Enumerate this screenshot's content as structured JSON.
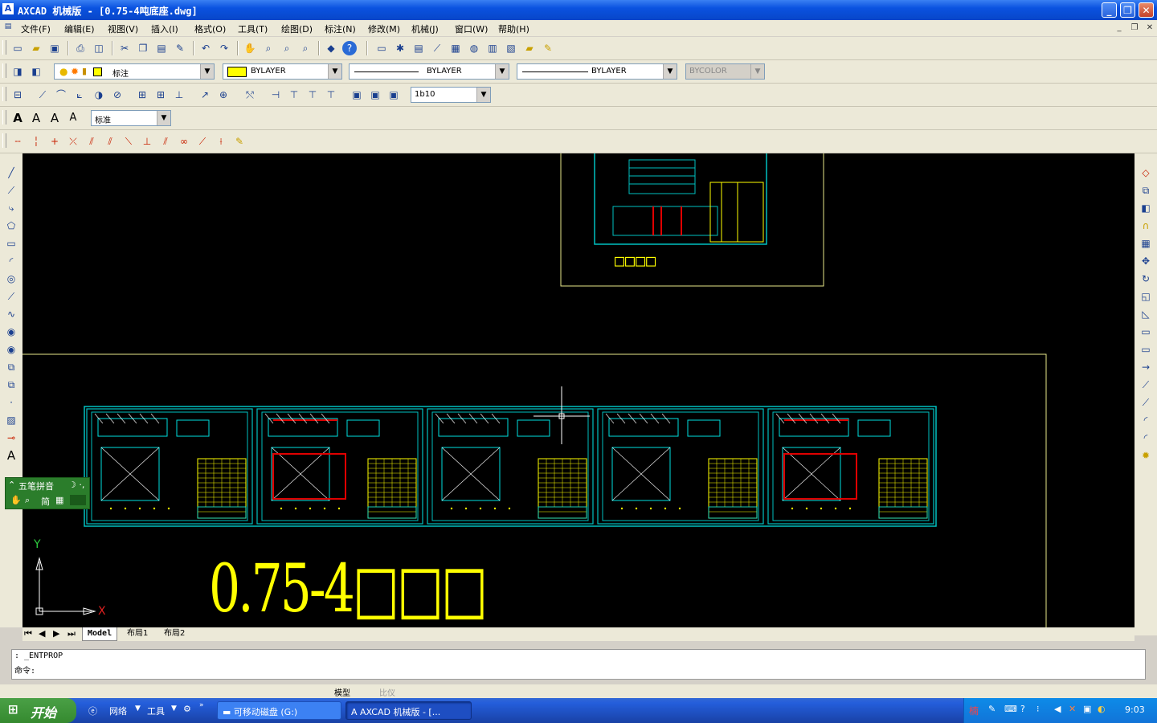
{
  "window": {
    "title": "AXCAD 机械版 - [0.75-4吨底座.dwg]",
    "app_icon": "A"
  },
  "menu": [
    "文件(F)",
    "编辑(E)",
    "视图(V)",
    "插入(I)",
    "格式(O)",
    "工具(T)",
    "绘图(D)",
    "标注(N)",
    "修改(M)",
    "机械(J)",
    "窗口(W)",
    "帮助(H)"
  ],
  "layer_bar": {
    "layer": "标注",
    "color": "BYLAYER",
    "linetype": "BYLAYER",
    "lineweight": "BYLAYER",
    "plotstyle": "BYCOLOR",
    "color_swatch": "#ffff00"
  },
  "dim_bar": {
    "scale": "1b10"
  },
  "text_bar": {
    "style": "标准"
  },
  "drawing": {
    "top_label": "□□□□",
    "big_title": "0.75-4□□□",
    "axis_x": "X",
    "axis_y": "Y"
  },
  "tabs": [
    "Model",
    "布局1",
    "布局2"
  ],
  "command": {
    "line1": ": _ENTPROP",
    "line2": "命令:"
  },
  "status": {
    "model": "模型",
    "digitizer": "比仪"
  },
  "ime": {
    "name": "五笔拼音",
    "mode": "简"
  },
  "taskbar": {
    "start": "开始",
    "network": "网络",
    "tools": "工具",
    "tasks": [
      "可移动磁盘 (G:)",
      "AXCAD 机械版 - [..."
    ],
    "clock": "9:03"
  }
}
